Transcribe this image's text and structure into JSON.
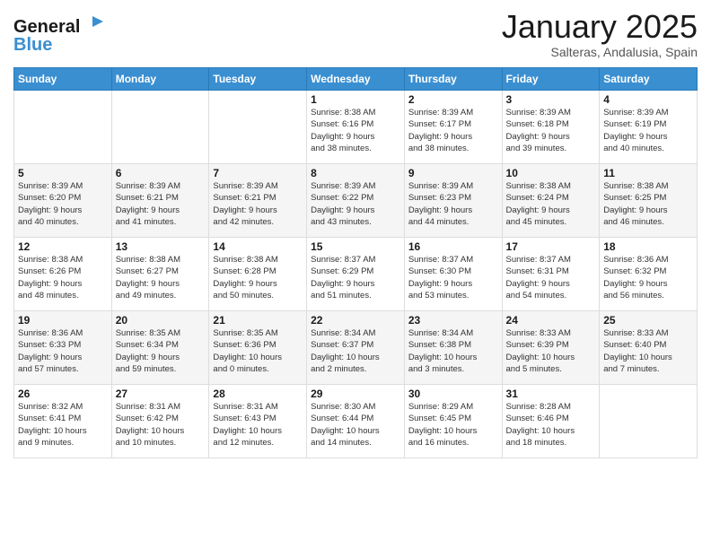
{
  "logo": {
    "line1": "General",
    "line2": "Blue"
  },
  "header": {
    "title": "January 2025",
    "subtitle": "Salteras, Andalusia, Spain"
  },
  "weekdays": [
    "Sunday",
    "Monday",
    "Tuesday",
    "Wednesday",
    "Thursday",
    "Friday",
    "Saturday"
  ],
  "weeks": [
    [
      {
        "day": "",
        "info": ""
      },
      {
        "day": "",
        "info": ""
      },
      {
        "day": "",
        "info": ""
      },
      {
        "day": "1",
        "info": "Sunrise: 8:38 AM\nSunset: 6:16 PM\nDaylight: 9 hours\nand 38 minutes."
      },
      {
        "day": "2",
        "info": "Sunrise: 8:39 AM\nSunset: 6:17 PM\nDaylight: 9 hours\nand 38 minutes."
      },
      {
        "day": "3",
        "info": "Sunrise: 8:39 AM\nSunset: 6:18 PM\nDaylight: 9 hours\nand 39 minutes."
      },
      {
        "day": "4",
        "info": "Sunrise: 8:39 AM\nSunset: 6:19 PM\nDaylight: 9 hours\nand 40 minutes."
      }
    ],
    [
      {
        "day": "5",
        "info": "Sunrise: 8:39 AM\nSunset: 6:20 PM\nDaylight: 9 hours\nand 40 minutes."
      },
      {
        "day": "6",
        "info": "Sunrise: 8:39 AM\nSunset: 6:21 PM\nDaylight: 9 hours\nand 41 minutes."
      },
      {
        "day": "7",
        "info": "Sunrise: 8:39 AM\nSunset: 6:21 PM\nDaylight: 9 hours\nand 42 minutes."
      },
      {
        "day": "8",
        "info": "Sunrise: 8:39 AM\nSunset: 6:22 PM\nDaylight: 9 hours\nand 43 minutes."
      },
      {
        "day": "9",
        "info": "Sunrise: 8:39 AM\nSunset: 6:23 PM\nDaylight: 9 hours\nand 44 minutes."
      },
      {
        "day": "10",
        "info": "Sunrise: 8:38 AM\nSunset: 6:24 PM\nDaylight: 9 hours\nand 45 minutes."
      },
      {
        "day": "11",
        "info": "Sunrise: 8:38 AM\nSunset: 6:25 PM\nDaylight: 9 hours\nand 46 minutes."
      }
    ],
    [
      {
        "day": "12",
        "info": "Sunrise: 8:38 AM\nSunset: 6:26 PM\nDaylight: 9 hours\nand 48 minutes."
      },
      {
        "day": "13",
        "info": "Sunrise: 8:38 AM\nSunset: 6:27 PM\nDaylight: 9 hours\nand 49 minutes."
      },
      {
        "day": "14",
        "info": "Sunrise: 8:38 AM\nSunset: 6:28 PM\nDaylight: 9 hours\nand 50 minutes."
      },
      {
        "day": "15",
        "info": "Sunrise: 8:37 AM\nSunset: 6:29 PM\nDaylight: 9 hours\nand 51 minutes."
      },
      {
        "day": "16",
        "info": "Sunrise: 8:37 AM\nSunset: 6:30 PM\nDaylight: 9 hours\nand 53 minutes."
      },
      {
        "day": "17",
        "info": "Sunrise: 8:37 AM\nSunset: 6:31 PM\nDaylight: 9 hours\nand 54 minutes."
      },
      {
        "day": "18",
        "info": "Sunrise: 8:36 AM\nSunset: 6:32 PM\nDaylight: 9 hours\nand 56 minutes."
      }
    ],
    [
      {
        "day": "19",
        "info": "Sunrise: 8:36 AM\nSunset: 6:33 PM\nDaylight: 9 hours\nand 57 minutes."
      },
      {
        "day": "20",
        "info": "Sunrise: 8:35 AM\nSunset: 6:34 PM\nDaylight: 9 hours\nand 59 minutes."
      },
      {
        "day": "21",
        "info": "Sunrise: 8:35 AM\nSunset: 6:36 PM\nDaylight: 10 hours\nand 0 minutes."
      },
      {
        "day": "22",
        "info": "Sunrise: 8:34 AM\nSunset: 6:37 PM\nDaylight: 10 hours\nand 2 minutes."
      },
      {
        "day": "23",
        "info": "Sunrise: 8:34 AM\nSunset: 6:38 PM\nDaylight: 10 hours\nand 3 minutes."
      },
      {
        "day": "24",
        "info": "Sunrise: 8:33 AM\nSunset: 6:39 PM\nDaylight: 10 hours\nand 5 minutes."
      },
      {
        "day": "25",
        "info": "Sunrise: 8:33 AM\nSunset: 6:40 PM\nDaylight: 10 hours\nand 7 minutes."
      }
    ],
    [
      {
        "day": "26",
        "info": "Sunrise: 8:32 AM\nSunset: 6:41 PM\nDaylight: 10 hours\nand 9 minutes."
      },
      {
        "day": "27",
        "info": "Sunrise: 8:31 AM\nSunset: 6:42 PM\nDaylight: 10 hours\nand 10 minutes."
      },
      {
        "day": "28",
        "info": "Sunrise: 8:31 AM\nSunset: 6:43 PM\nDaylight: 10 hours\nand 12 minutes."
      },
      {
        "day": "29",
        "info": "Sunrise: 8:30 AM\nSunset: 6:44 PM\nDaylight: 10 hours\nand 14 minutes."
      },
      {
        "day": "30",
        "info": "Sunrise: 8:29 AM\nSunset: 6:45 PM\nDaylight: 10 hours\nand 16 minutes."
      },
      {
        "day": "31",
        "info": "Sunrise: 8:28 AM\nSunset: 6:46 PM\nDaylight: 10 hours\nand 18 minutes."
      },
      {
        "day": "",
        "info": ""
      }
    ]
  ]
}
